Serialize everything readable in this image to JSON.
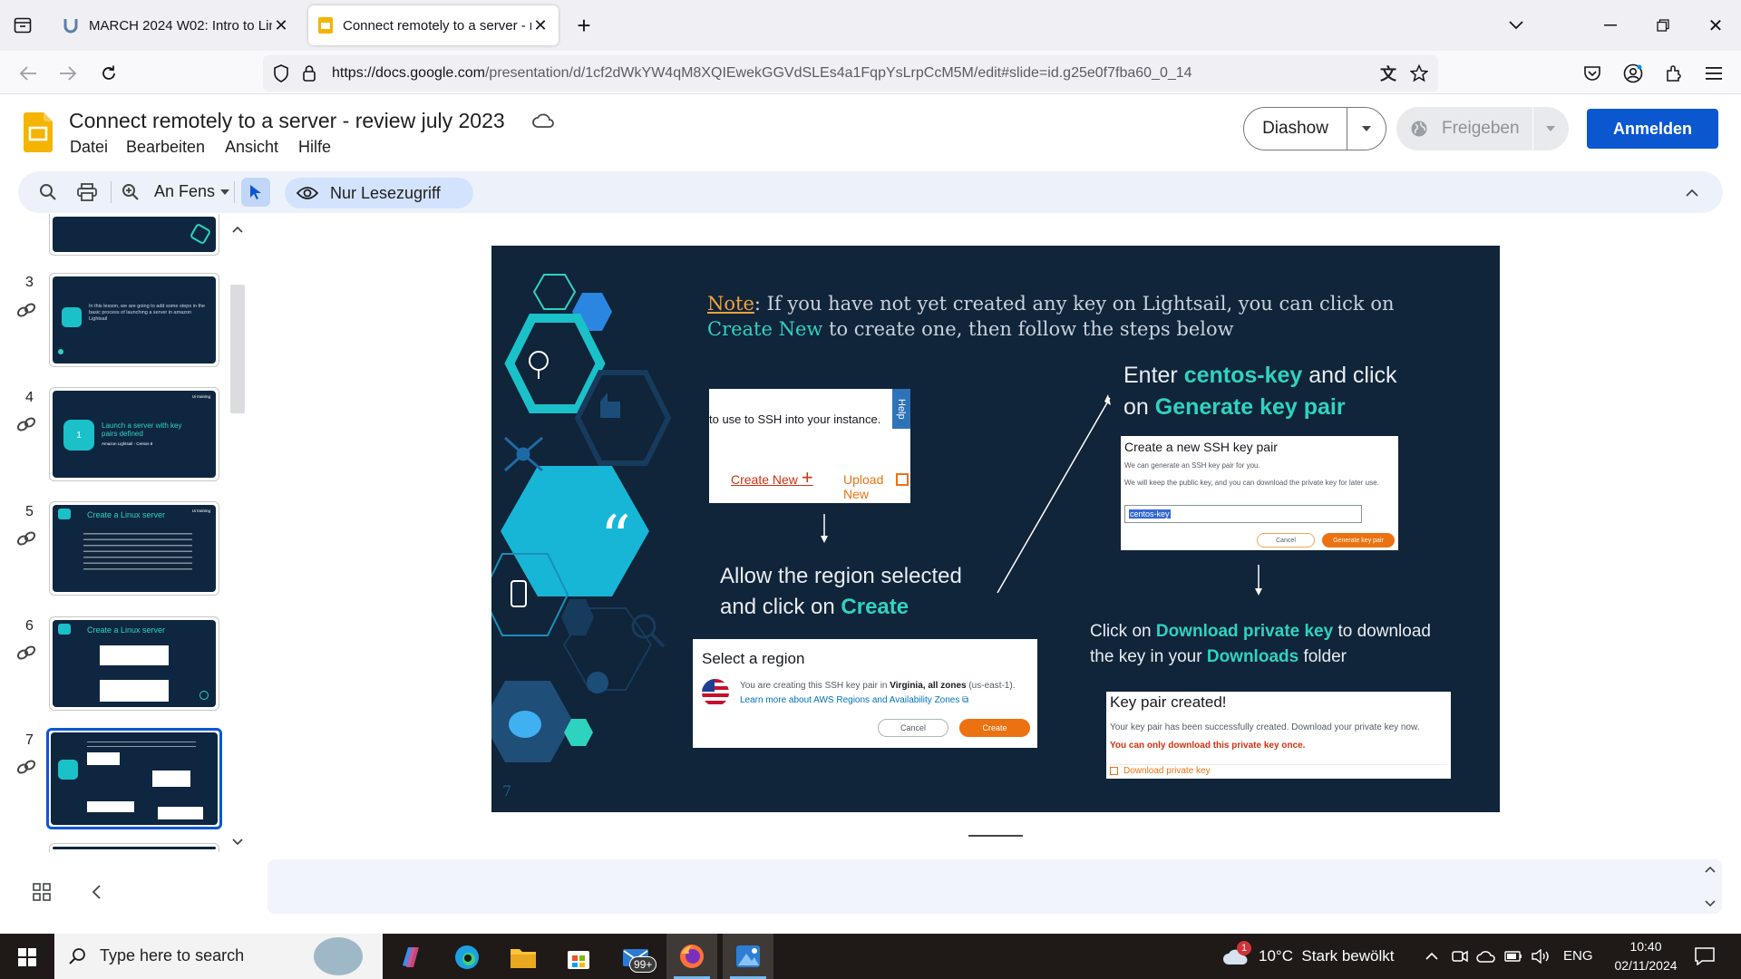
{
  "browser": {
    "tabs": [
      {
        "title": "MARCH 2024 W02: Intro to Linu",
        "active": false
      },
      {
        "title": "Connect remotely to a server - r",
        "active": true
      }
    ],
    "url_domain": "https://docs.google.com",
    "url_path": "/presentation/d/1cf2dWkYW4qM8XQIEwekGGVdSLEs4a1FqpYsLrpCcM5M/edit#slide=id.g25e0f7fba60_0_14"
  },
  "doc": {
    "title": "Connect remotely to a server - review july 2023",
    "menu": [
      "Datei",
      "Bearbeiten",
      "Ansicht",
      "Hilfe"
    ],
    "buttons": {
      "slideshow": "Diashow",
      "share": "Freigeben",
      "signin": "Anmelden"
    }
  },
  "toolbar": {
    "zoom_label": "An Fens",
    "readonly_label": "Nur Lesezugriff"
  },
  "filmstrip": {
    "numbers": [
      "3",
      "4",
      "5",
      "6",
      "7"
    ],
    "selected": "7",
    "thumb3_text": "In this lesson, we are going to add some steps in the basic process of launching a server in amazon Lightsail",
    "thumb4_title": "Launch a server with key pairs defined",
    "thumb4_sub": "Amazon Lightsail - Centos 8",
    "thumb4_num": "1",
    "thumb5_title": "Create a Linux server",
    "thumb6_title": "Create a Linux server",
    "brand": "Ui training"
  },
  "slide": {
    "note_label": "Note",
    "note_text": ": If you have not yet created any key on Lightsail, you can click on ",
    "note_highlight": "Create New",
    "note_tail": " to create one, then follow the steps below",
    "card1": {
      "text": "to use to SSH into your instance.",
      "create": "Create New",
      "upload": "Upload New",
      "help": "Help"
    },
    "step_region_a": "Allow the region selected",
    "step_region_b": "and click on ",
    "step_region_hl": "Create",
    "region_card": {
      "title": "Select a region",
      "line1": "You are creating this SSH key pair in ",
      "line1_bold": "Virginia, all zones",
      "line1_tail": " (us-east-1).",
      "link": "Learn more about AWS Regions and Availability Zones",
      "cancel": "Cancel",
      "create": "Create"
    },
    "step_key_a": "Enter ",
    "step_key_hl": "centos-key",
    "step_key_b": " and click",
    "step_key_c": "on ",
    "step_key_hl2": "Generate key pair",
    "keypair_card": {
      "title": "Create a new SSH key pair",
      "line1": "We can generate an SSH key pair for you.",
      "line2": "We will keep the public key, and you can download the private key for later use.",
      "input": "centos-key",
      "cancel": "Cancel",
      "generate": "Generate key pair"
    },
    "step_dl_a": "Click on ",
    "step_dl_hl": "Download private key",
    "step_dl_b": " to download",
    "step_dl_c": "the key in your ",
    "step_dl_hl2": "Downloads",
    "step_dl_d": " folder",
    "created_card": {
      "title": "Key pair created!",
      "line1": "Your key pair has been successfully created. Download your private key now.",
      "warn": "You can only download this private key once.",
      "download": "Download private key"
    },
    "page_number": "7"
  },
  "taskbar": {
    "search_placeholder": "Type here to search",
    "mail_badge": "99+",
    "weather_badge": "1",
    "weather": "10°C  Stark bewölkt",
    "lang": "ENG",
    "time": "10:40",
    "date": "02/11/2024"
  },
  "colors": {
    "accent": "#0b57d0",
    "slide_bg": "#10243a",
    "teal": "#2ed3c0",
    "aws_orange": "#ec7211"
  }
}
